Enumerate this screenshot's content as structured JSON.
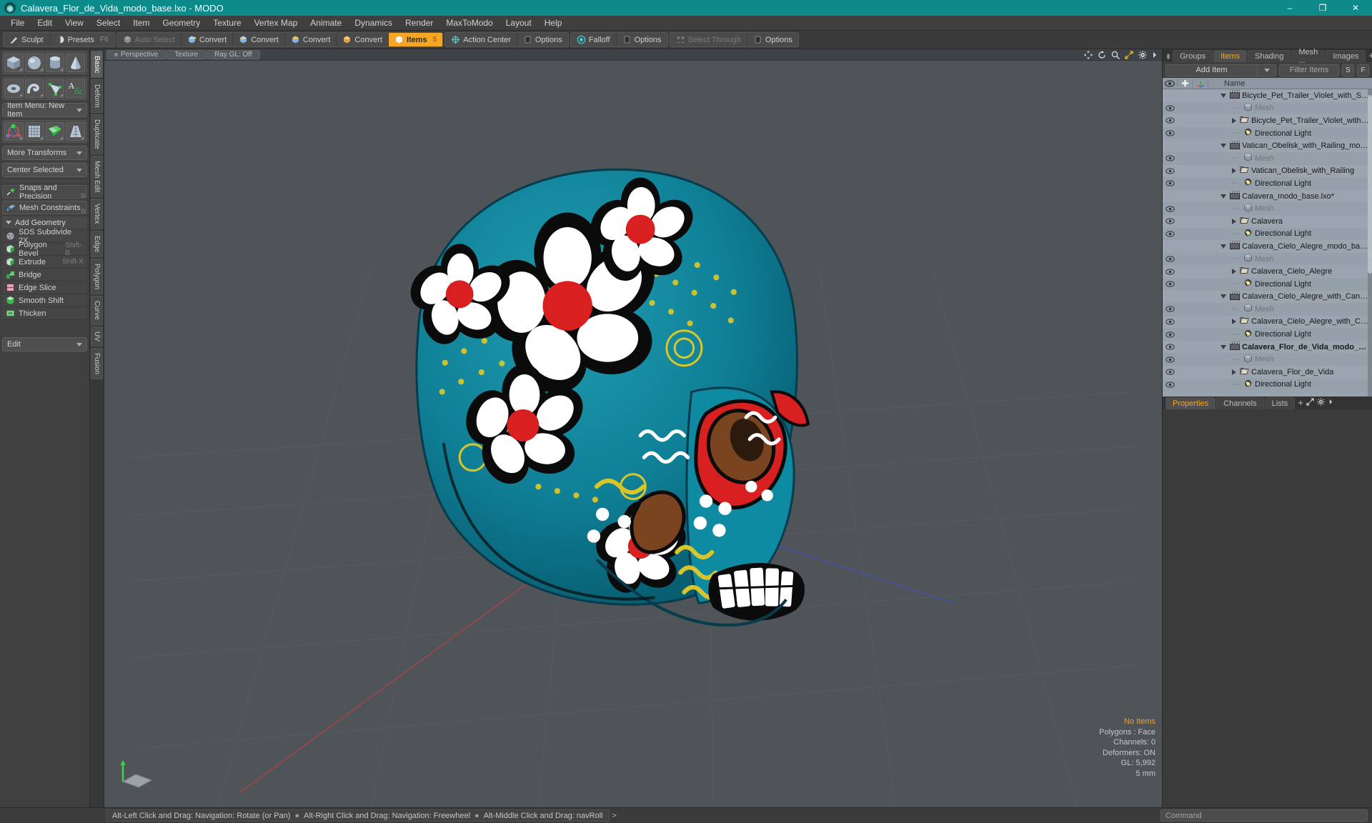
{
  "titlebar": {
    "title": "Calavera_Flor_de_Vida_modo_base.lxo - MODO",
    "app_icon": "modo-logo-icon",
    "minimize": "–",
    "maximize": "❐",
    "close": "✕"
  },
  "menubar": {
    "items": [
      "File",
      "Edit",
      "View",
      "Select",
      "Item",
      "Geometry",
      "Texture",
      "Vertex Map",
      "Animate",
      "Dynamics",
      "Render",
      "MaxToModo",
      "Layout",
      "Help"
    ]
  },
  "modebar": {
    "group1": [
      {
        "label": "Sculpt",
        "icon": "sculpt-brush-icon",
        "shortcut": "",
        "state": "normal"
      },
      {
        "label": "Presets",
        "icon": "presets-sphere-icon",
        "shortcut": "F6",
        "state": "normal"
      }
    ],
    "group2": [
      {
        "label": "Auto Select",
        "icon": "cube-grey-icon",
        "shortcut": "",
        "state": "dim"
      },
      {
        "label": "Convert",
        "icon": "cube-vertex-icon",
        "shortcut": "",
        "state": "normal"
      },
      {
        "label": "Convert",
        "icon": "cube-edge-icon",
        "shortcut": "",
        "state": "normal"
      },
      {
        "label": "Convert",
        "icon": "cube-polygon-icon",
        "shortcut": "",
        "state": "normal"
      },
      {
        "label": "Convert",
        "icon": "cube-material-icon",
        "shortcut": "",
        "state": "normal"
      },
      {
        "label": "Items",
        "icon": "items-cube-icon",
        "shortcut": "5",
        "state": "active"
      },
      {
        "label": "Action Center",
        "icon": "action-center-icon",
        "shortcut": "",
        "state": "normal"
      },
      {
        "label": "Options",
        "icon": "options-square-icon",
        "shortcut": "",
        "state": "normal"
      },
      {
        "label": "Falloff",
        "icon": "falloff-target-icon",
        "shortcut": "",
        "state": "normal"
      },
      {
        "label": "Options",
        "icon": "options-square-icon",
        "shortcut": "",
        "state": "normal"
      },
      {
        "label": "Select Through",
        "icon": "select-through-icon",
        "shortcut": "",
        "state": "dim"
      },
      {
        "label": "Options",
        "icon": "options-square-icon",
        "shortcut": "",
        "state": "normal"
      }
    ]
  },
  "left_panel": {
    "primitives_row1": [
      {
        "icon": "cube-primitive-icon",
        "name": "Cube"
      },
      {
        "icon": "sphere-primitive-icon",
        "name": "Sphere"
      },
      {
        "icon": "cylinder-primitive-icon",
        "name": "Cylinder"
      },
      {
        "icon": "cone-primitive-icon",
        "name": "Cone"
      }
    ],
    "primitives_row2": [
      {
        "icon": "torus-primitive-icon",
        "name": "Torus"
      },
      {
        "icon": "tube-primitive-icon",
        "name": "Tube"
      },
      {
        "icon": "curve-primitive-icon",
        "name": "Curve"
      },
      {
        "icon": "text-primitive-icon",
        "name": "Text"
      }
    ],
    "item_menu": "Item Menu: New Item",
    "transform_row": [
      {
        "icon": "transform-gizmo-icon",
        "name": "Transform"
      },
      {
        "icon": "grid-bend-icon",
        "name": "Bend"
      },
      {
        "icon": "green-checker-icon",
        "name": "Shear"
      },
      {
        "icon": "taper-grid-icon",
        "name": "Taper"
      }
    ],
    "more_transforms": "More Transforms",
    "center_selected": "Center Selected",
    "snaps": "Snaps and Precision",
    "mesh_constraints": "Mesh Constraints",
    "add_geometry_header": "Add Geometry",
    "commands": [
      {
        "label": "SDS Subdivide 2X",
        "shortcut": "",
        "icon": "sds-subdivide-icon"
      },
      {
        "label": "Polygon Bevel",
        "shortcut": "Shift-B",
        "icon": "polygon-bevel-icon"
      },
      {
        "label": "Extrude",
        "shortcut": "Shift-X",
        "icon": "extrude-icon"
      },
      {
        "label": "Bridge",
        "shortcut": "",
        "icon": "bridge-icon"
      },
      {
        "label": "Edge Slice",
        "shortcut": "",
        "icon": "edge-slice-icon"
      },
      {
        "label": "Smooth Shift",
        "shortcut": "",
        "icon": "smooth-shift-icon"
      },
      {
        "label": "Thicken",
        "shortcut": "",
        "icon": "thicken-icon"
      }
    ],
    "edit_dropdown": "Edit"
  },
  "vtabs": {
    "items": [
      {
        "label": "Basic",
        "selected": true
      },
      {
        "label": "Deform",
        "selected": false
      },
      {
        "label": "Duplicate",
        "selected": false
      },
      {
        "label": "Mesh Edit",
        "selected": false
      },
      {
        "label": "Vertex",
        "selected": false
      },
      {
        "label": "Edge",
        "selected": false
      },
      {
        "label": "Polygon",
        "selected": false
      },
      {
        "label": "Curve",
        "selected": false
      },
      {
        "label": "UV",
        "selected": false
      },
      {
        "label": "Fusion",
        "selected": false
      }
    ]
  },
  "viewport": {
    "tags": [
      "Perspective",
      "Texture",
      "Ray GL: Off"
    ],
    "nav_icons": [
      "move-icon",
      "rotate-icon",
      "zoom-icon",
      "fit-icon",
      "gear-icon",
      "chevron-right-icon"
    ],
    "stats": {
      "items": "No Items",
      "polygons": "Polygons : Face",
      "channels": "Channels: 0",
      "deformers": "Deformers: ON",
      "gl": "GL: 5,992",
      "size": "5 mm"
    },
    "axis_widget": "axis-gizmo-icon"
  },
  "right_panel": {
    "tabs": [
      {
        "label": "Groups",
        "selected": false
      },
      {
        "label": "Items",
        "selected": true
      },
      {
        "label": "Shading",
        "selected": false
      },
      {
        "label": "Mesh ...",
        "selected": false
      },
      {
        "label": "Images",
        "selected": false
      }
    ],
    "tab_add": "+",
    "tab_icons": [
      "expand-icon",
      "gear-icon",
      "chevron-right-icon"
    ],
    "add_item_label": "Add Item",
    "filter_placeholder": "Filter Items",
    "filter_buttons": [
      "S",
      "F"
    ],
    "tree_columns": [
      "eye-icon",
      "plus-icon",
      "axis-icon",
      "Name"
    ],
    "tree_rows": [
      {
        "name": "Bicycle_Pet_Trailer_Violet_with_Sphynx_m ...",
        "depth": 0,
        "toggle": "down",
        "icon": "scene-clapper-icon",
        "eye": false,
        "dim": false,
        "bold": false
      },
      {
        "name": "Mesh",
        "depth": 1,
        "toggle": "leaf",
        "icon": "mesh-cube-icon",
        "eye": true,
        "dim": true,
        "bold": false
      },
      {
        "name": "Bicycle_Pet_Trailer_Violet_with_Sphynx",
        "depth": 1,
        "toggle": "right",
        "icon": "folder-mesh-icon",
        "eye": true,
        "dim": false,
        "bold": false
      },
      {
        "name": "Directional Light",
        "depth": 1,
        "toggle": "leaf",
        "icon": "light-icon",
        "eye": true,
        "dim": false,
        "bold": false
      },
      {
        "name": "Vatican_Obelisk_with_Railing_modo_base.lxo",
        "depth": 0,
        "toggle": "down",
        "icon": "scene-clapper-icon",
        "eye": false,
        "dim": false,
        "bold": false
      },
      {
        "name": "Mesh",
        "depth": 1,
        "toggle": "leaf",
        "icon": "mesh-cube-icon",
        "eye": true,
        "dim": true,
        "bold": false
      },
      {
        "name": "Vatican_Obelisk_with_Railing",
        "depth": 1,
        "toggle": "right",
        "icon": "folder-mesh-icon",
        "eye": true,
        "dim": false,
        "bold": false
      },
      {
        "name": "Directional Light",
        "depth": 1,
        "toggle": "leaf",
        "icon": "light-icon",
        "eye": true,
        "dim": false,
        "bold": false
      },
      {
        "name": "Calavera_modo_base.lxo*",
        "depth": 0,
        "toggle": "down",
        "icon": "scene-clapper-icon",
        "eye": false,
        "dim": false,
        "bold": false
      },
      {
        "name": "Mesh",
        "depth": 1,
        "toggle": "leaf",
        "icon": "mesh-cube-icon",
        "eye": true,
        "dim": true,
        "bold": false
      },
      {
        "name": "Calavera",
        "depth": 1,
        "toggle": "right",
        "icon": "folder-mesh-icon",
        "eye": true,
        "dim": false,
        "bold": false
      },
      {
        "name": "Directional Light",
        "depth": 1,
        "toggle": "leaf",
        "icon": "light-icon",
        "eye": true,
        "dim": false,
        "bold": false
      },
      {
        "name": "Calavera_Cielo_Alegre_modo_base.lxo*",
        "depth": 0,
        "toggle": "down",
        "icon": "scene-clapper-icon",
        "eye": false,
        "dim": false,
        "bold": false
      },
      {
        "name": "Mesh",
        "depth": 1,
        "toggle": "leaf",
        "icon": "mesh-cube-icon",
        "eye": true,
        "dim": true,
        "bold": false
      },
      {
        "name": "Calavera_Cielo_Alegre",
        "depth": 1,
        "toggle": "right",
        "icon": "folder-mesh-icon",
        "eye": true,
        "dim": false,
        "bold": false
      },
      {
        "name": "Directional Light",
        "depth": 1,
        "toggle": "leaf",
        "icon": "light-icon",
        "eye": true,
        "dim": false,
        "bold": false
      },
      {
        "name": "Calavera_Cielo_Alegre_with_Candles_mod ...",
        "depth": 0,
        "toggle": "down",
        "icon": "scene-clapper-icon",
        "eye": false,
        "dim": false,
        "bold": false
      },
      {
        "name": "Mesh",
        "depth": 1,
        "toggle": "leaf",
        "icon": "mesh-cube-icon",
        "eye": true,
        "dim": true,
        "bold": false
      },
      {
        "name": "Calavera_Cielo_Alegre_with_Candles",
        "depth": 1,
        "toggle": "right",
        "icon": "folder-mesh-icon",
        "eye": true,
        "dim": false,
        "bold": false
      },
      {
        "name": "Directional Light",
        "depth": 1,
        "toggle": "leaf",
        "icon": "light-icon",
        "eye": true,
        "dim": false,
        "bold": false
      },
      {
        "name": "Calavera_Flor_de_Vida_modo_base....",
        "depth": 0,
        "toggle": "down",
        "icon": "scene-clapper-icon",
        "eye": true,
        "dim": false,
        "bold": true
      },
      {
        "name": "Mesh",
        "depth": 1,
        "toggle": "leaf",
        "icon": "mesh-cube-icon",
        "eye": true,
        "dim": true,
        "bold": false
      },
      {
        "name": "Calavera_Flor_de_Vida",
        "depth": 1,
        "toggle": "right",
        "icon": "folder-mesh-icon",
        "eye": true,
        "dim": false,
        "bold": false
      },
      {
        "name": "Directional Light",
        "depth": 1,
        "toggle": "leaf",
        "icon": "light-icon",
        "eye": true,
        "dim": false,
        "bold": false
      }
    ],
    "props_tabs": [
      {
        "label": "Properties",
        "selected": true
      },
      {
        "label": "Channels",
        "selected": false
      },
      {
        "label": "Lists",
        "selected": false
      }
    ],
    "props_add": "+"
  },
  "bottom": {
    "hint1": "Alt-Left Click and Drag: Navigation: Rotate (or Pan)",
    "hint2": "Alt-Right Click and Drag: Navigation: Freewheel",
    "hint3": "Alt-Middle Click and Drag: navRoll",
    "command_placeholder": "Command",
    "command_chevron": ">"
  },
  "colors": {
    "title_bg": "#0d8b8b",
    "accent_orange": "#f5a623",
    "tree_bg": "#9aa3ad",
    "viewport_bg": "#4f5459"
  }
}
